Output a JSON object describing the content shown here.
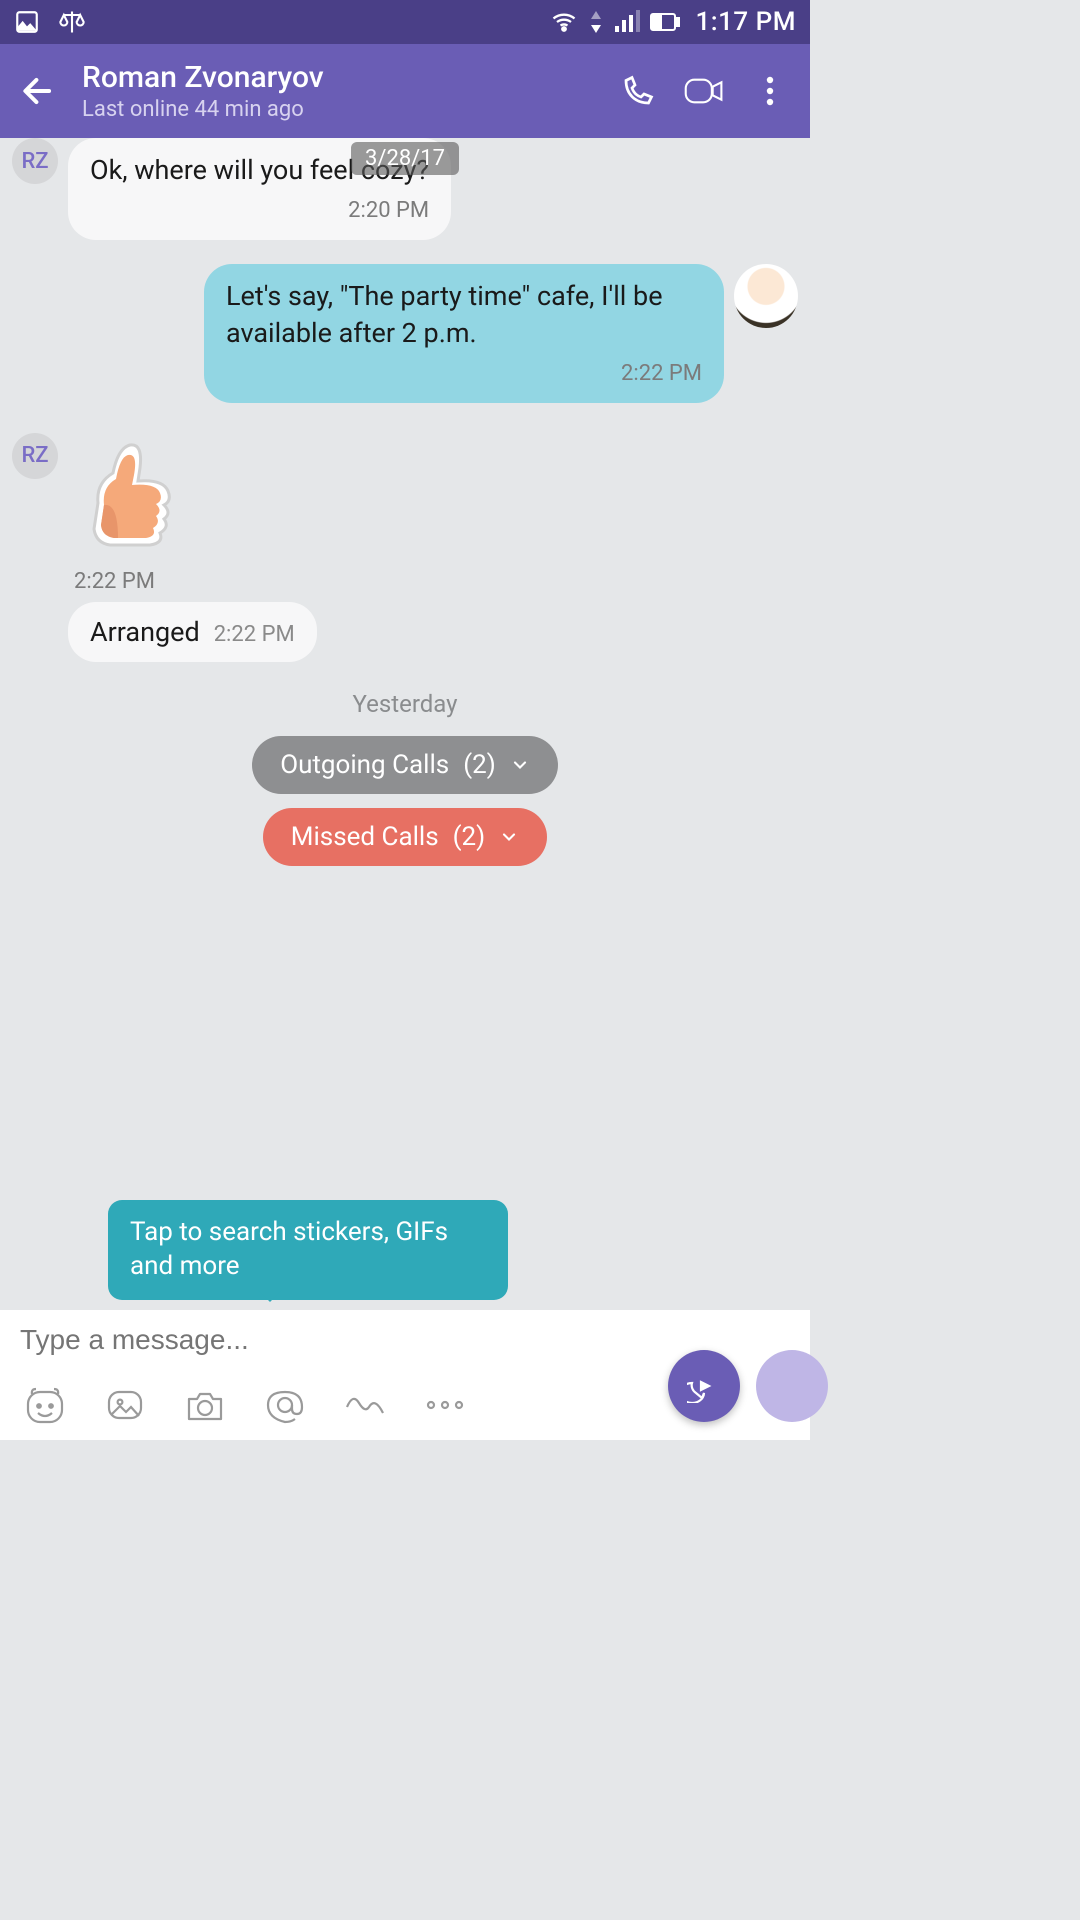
{
  "status": {
    "time": "1:17 PM"
  },
  "header": {
    "contact_name": "Roman Zvonaryov",
    "last_online": "Last online 44 min ago"
  },
  "date_pill": "3/28/17",
  "avatar_initials": "RZ",
  "messages": {
    "m0": {
      "text": "Ok, where will you feel cozy?",
      "time": "2:20 PM"
    },
    "m1": {
      "text": "Let's say, \"The party time\" cafe, I'll be available after 2 p.m.",
      "time": "2:22 PM"
    },
    "sticker_time": "2:22 PM",
    "m2": {
      "text": "Arranged",
      "time": "2:22 PM"
    }
  },
  "day_separator": "Yesterday",
  "calls": {
    "outgoing": {
      "label": "Outgoing Calls",
      "count": "(2)"
    },
    "missed": {
      "label": "Missed Calls",
      "count": "(2)"
    }
  },
  "tooltip": "Tap to search stickers, GIFs and more",
  "composer": {
    "placeholder": "Type a message..."
  }
}
